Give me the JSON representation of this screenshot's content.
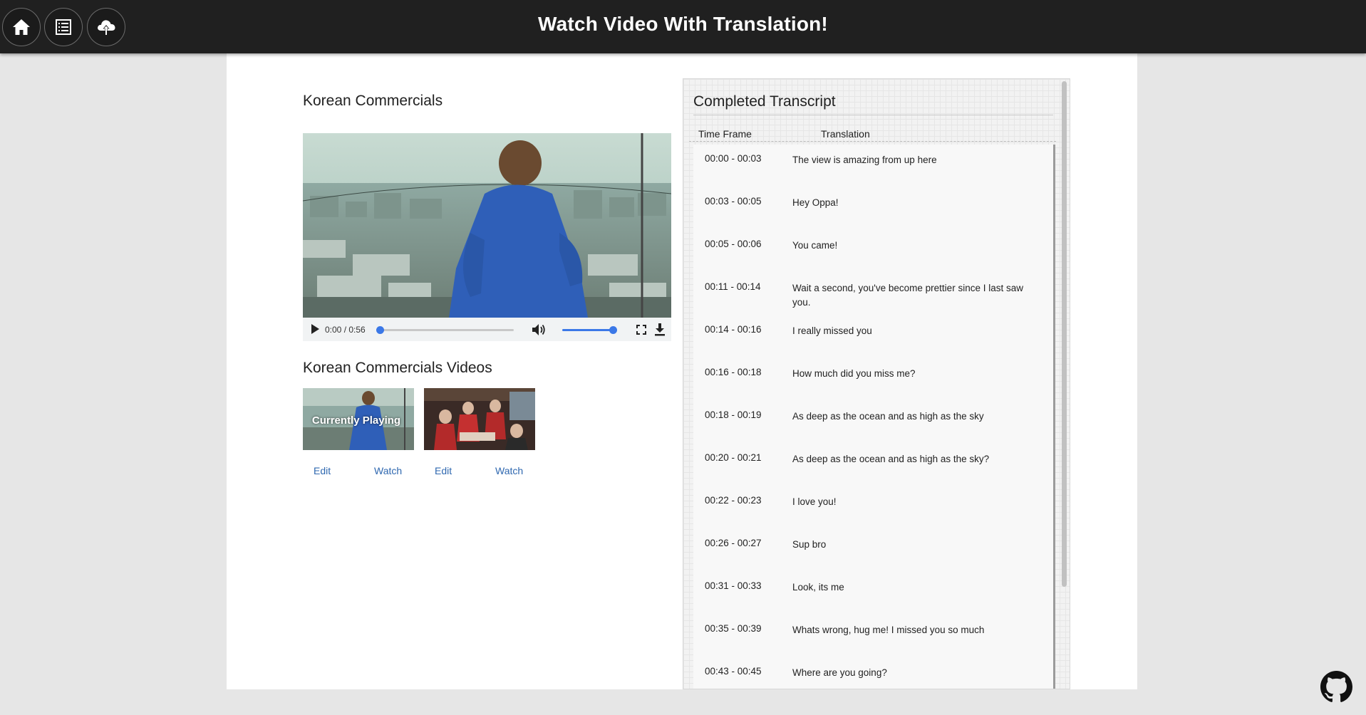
{
  "header": {
    "title": "Watch Video With Translation!",
    "nav": [
      {
        "name": "home-button",
        "icon": "home-icon"
      },
      {
        "name": "list-button",
        "icon": "list-icon"
      },
      {
        "name": "upload-button",
        "icon": "cloud-upload-icon"
      }
    ]
  },
  "player": {
    "title": "Korean Commercials",
    "time": "0:00 / 0:56",
    "progress": 0,
    "volume": 1
  },
  "videos": {
    "title": "Korean Commercials Videos",
    "items": [
      {
        "overlay": "Currently Playing",
        "edit": "Edit",
        "watch": "Watch"
      },
      {
        "overlay": "",
        "edit": "Edit",
        "watch": "Watch"
      }
    ]
  },
  "transcript": {
    "title": "Completed Transcript",
    "col_time": "Time Frame",
    "col_translation": "Translation",
    "rows": [
      {
        "time": "00:00 - 00:03",
        "text": "The view is amazing from up here"
      },
      {
        "time": "00:03 - 00:05",
        "text": "Hey Oppa!"
      },
      {
        "time": "00:05 - 00:06",
        "text": "You came!"
      },
      {
        "time": "00:11 - 00:14",
        "text": "Wait a second, you've become prettier since I last saw you."
      },
      {
        "time": "00:14 - 00:16",
        "text": "I really missed you"
      },
      {
        "time": "00:16 - 00:18",
        "text": "How much did you miss me?"
      },
      {
        "time": "00:18 - 00:19",
        "text": "As deep as the ocean and as high as the sky"
      },
      {
        "time": "00:20 - 00:21",
        "text": "As deep as the ocean and as high as the sky?"
      },
      {
        "time": "00:22 - 00:23",
        "text": "I love you!"
      },
      {
        "time": "00:26 - 00:27",
        "text": "Sup bro"
      },
      {
        "time": "00:31 - 00:33",
        "text": "Look, its me"
      },
      {
        "time": "00:35 - 00:39",
        "text": "Whats wrong, hug me! I missed you so much"
      },
      {
        "time": "00:43 - 00:45",
        "text": "Where are you going?"
      }
    ]
  },
  "colors": {
    "header_bg": "#202020",
    "accent": "#3b78e7",
    "link": "#2f68b0"
  }
}
